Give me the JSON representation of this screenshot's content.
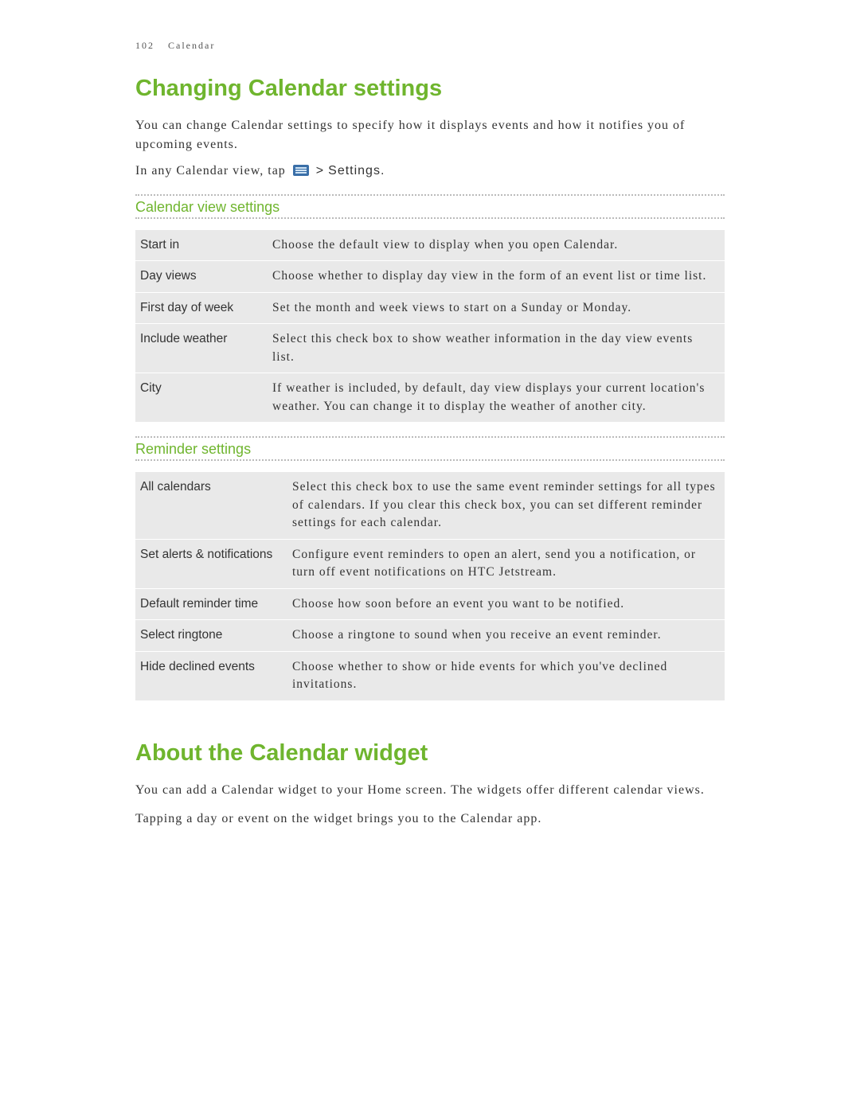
{
  "header": {
    "page_number": "102",
    "section": "Calendar"
  },
  "section1": {
    "title": "Changing Calendar settings",
    "intro": "You can change Calendar settings to specify how it displays events and how it notifies you of upcoming events.",
    "tap_prefix": "In any Calendar view, tap",
    "tap_gt": ">",
    "tap_settings": "Settings."
  },
  "subsections": {
    "view": {
      "title": "Calendar view settings",
      "rows": [
        {
          "term": "Start in",
          "desc": "Choose the default view to display when you open Calendar."
        },
        {
          "term": "Day views",
          "desc": "Choose whether to display day view in the form of an event list or time list."
        },
        {
          "term": "First day of week",
          "desc": "Set the month and week views to start on a Sunday or Monday."
        },
        {
          "term": "Include weather",
          "desc": "Select this check box to show weather information in the day view events list."
        },
        {
          "term": "City",
          "desc": "If weather is included, by default, day view displays your current location's weather. You can change it to display the weather of another city."
        }
      ]
    },
    "reminder": {
      "title": "Reminder settings",
      "rows": [
        {
          "term": "All calendars",
          "desc": "Select this check box to use the same event reminder settings for all types of calendars. If you clear this check box, you can set different reminder settings for each calendar."
        },
        {
          "term": "Set alerts & notifications",
          "desc": "Configure event reminders to open an alert, send you a notification, or turn off event notifications on HTC Jetstream."
        },
        {
          "term": "Default reminder time",
          "desc": "Choose how soon before an event you want to be notified."
        },
        {
          "term": "Select ringtone",
          "desc": "Choose a ringtone to sound when you receive an event reminder."
        },
        {
          "term": "Hide declined events",
          "desc": "Choose whether to show or hide events for which you've declined invitations."
        }
      ]
    }
  },
  "section2": {
    "title": "About the Calendar widget",
    "p1": "You can add a Calendar widget to your Home screen. The widgets offer different calendar views.",
    "p2": "Tapping a day or event on the widget brings you to the Calendar app."
  }
}
